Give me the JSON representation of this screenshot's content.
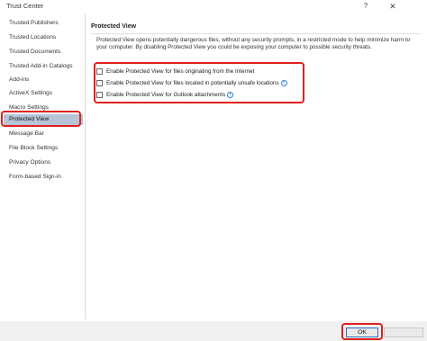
{
  "window": {
    "title": "Trust Center",
    "help_glyph": "?",
    "close_glyph": "✕"
  },
  "sidebar": {
    "items": [
      {
        "label": "Trusted Publishers"
      },
      {
        "label": "Trusted Locations"
      },
      {
        "label": "Trusted Documents"
      },
      {
        "label": "Trusted Add-in Catalogs"
      },
      {
        "label": "Add-ins"
      },
      {
        "label": "ActiveX Settings"
      },
      {
        "label": "Macro Settings"
      },
      {
        "label": "Protected View"
      },
      {
        "label": "Message Bar"
      },
      {
        "label": "File Block Settings"
      },
      {
        "label": "Privacy Options"
      },
      {
        "label": "Form-based Sign-in"
      }
    ],
    "selected_index": 7
  },
  "main": {
    "section_title": "Protected View",
    "description": "Protected View opens potentially dangerous files, without any security prompts, in a restricted mode to help minimize harm to your computer. By disabling Protected View you could be exposing your computer to possible security threats.",
    "options": [
      {
        "label": "Enable Protected View for files originating from the Internet",
        "checked": false,
        "has_info": false
      },
      {
        "label": "Enable Protected View for files located in potentially unsafe locations",
        "checked": false,
        "has_info": true
      },
      {
        "label": "Enable Protected View for Outlook attachments",
        "checked": false,
        "has_info": true
      }
    ],
    "info_glyph": "i"
  },
  "footer": {
    "ok_label": "OK"
  },
  "colors": {
    "highlight": "#e0201f",
    "selected_bg": "#b7c3d6",
    "ok_border": "#2a6ebf",
    "info": "#2a7fd4"
  }
}
